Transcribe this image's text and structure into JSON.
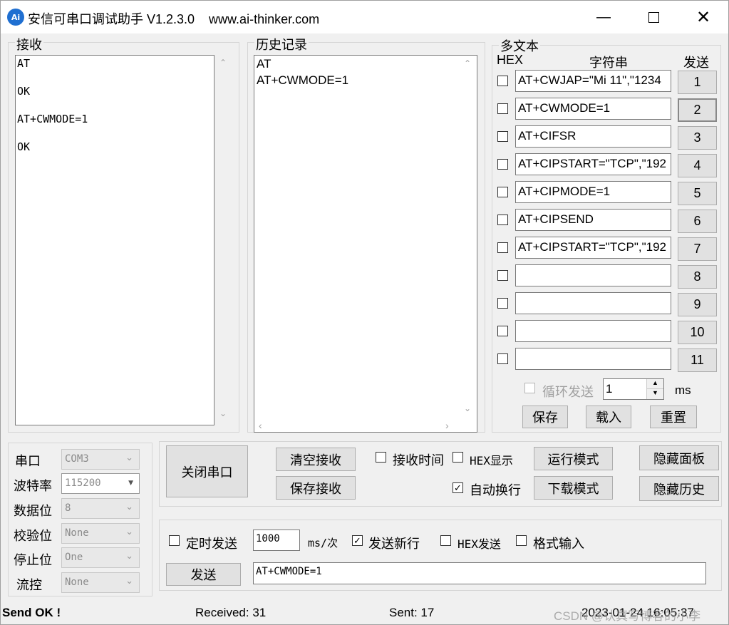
{
  "window": {
    "title": "安信可串口调试助手 V1.2.3.0    www.ai-thinker.com",
    "icon_text": "Ai"
  },
  "receive": {
    "title": "接收",
    "lines": [
      "AT",
      "OK",
      "AT+CWMODE=1",
      "OK"
    ]
  },
  "history": {
    "title": "历史记录",
    "lines": [
      "AT",
      "AT+CWMODE=1"
    ]
  },
  "multi": {
    "title": "多文本",
    "col_hex": "HEX",
    "col_string": "字符串",
    "col_send": "发送",
    "rows": [
      {
        "value": "AT+CWJAP=\"Mi 11\",\"1234",
        "button": "1"
      },
      {
        "value": "AT+CWMODE=1",
        "button": "2"
      },
      {
        "value": "AT+CIFSR",
        "button": "3"
      },
      {
        "value": "AT+CIPSTART=\"TCP\",\"192",
        "button": "4"
      },
      {
        "value": "AT+CIPMODE=1",
        "button": "5"
      },
      {
        "value": "AT+CIPSEND",
        "button": "6"
      },
      {
        "value": "AT+CIPSTART=\"TCP\",\"192",
        "button": "7"
      },
      {
        "value": "",
        "button": "8"
      },
      {
        "value": "",
        "button": "9"
      },
      {
        "value": "",
        "button": "10"
      },
      {
        "value": "",
        "button": "11"
      }
    ],
    "loop_send": "循环发送",
    "loop_interval": "1",
    "unit": "ms",
    "save": "保存",
    "load": "载入",
    "reset": "重置"
  },
  "port": {
    "port_label": "串口",
    "port_value": "COM3",
    "baud_label": "波特率",
    "baud_value": "115200",
    "data_label": "数据位",
    "data_value": "8",
    "parity_label": "校验位",
    "parity_value": "None",
    "stop_label": "停止位",
    "stop_value": "One",
    "flow_label": "流控",
    "flow_value": "None"
  },
  "controls": {
    "close_port": "关闭串口",
    "clear_receive": "清空接收",
    "save_receive": "保存接收",
    "receive_time": "接收时间",
    "hex_display": "HEX显示",
    "run_mode": "运行模式",
    "hide_panel": "隐藏面板",
    "auto_newline": "自动换行",
    "download_mode": "下载模式",
    "hide_history": "隐藏历史"
  },
  "send": {
    "timed_send": "定时发送",
    "interval": "1000",
    "interval_unit": "ms/次",
    "send_newline": "发送新行",
    "hex_send": "HEX发送",
    "format_input": "格式输入",
    "send_button": "发送",
    "send_text": "AT+CWMODE=1"
  },
  "status": {
    "state": "Send OK !",
    "received": "Received: 31",
    "sent": "Sent: 17",
    "watermark": "CSDN @认真写博客的小李",
    "datetime": "2023-01-24 16:05:37"
  }
}
